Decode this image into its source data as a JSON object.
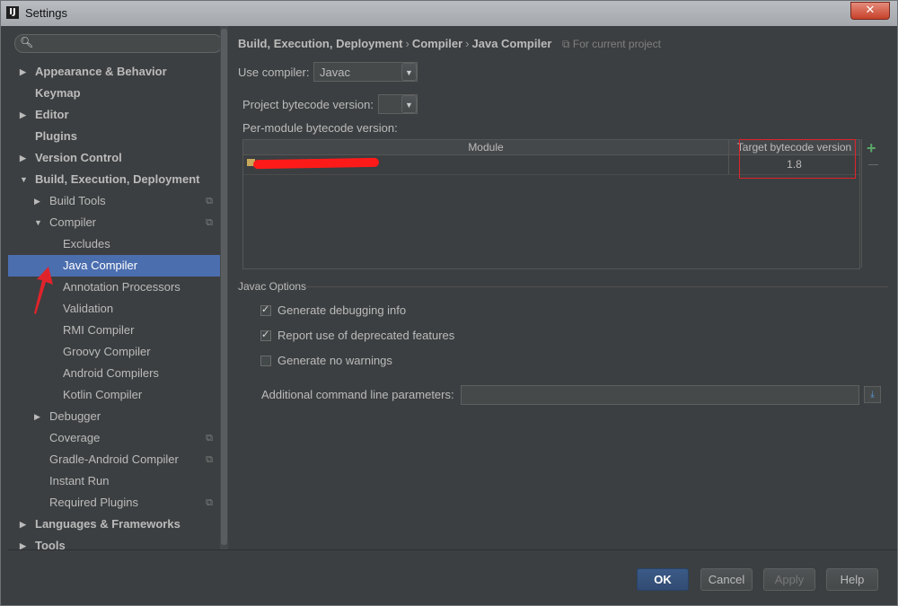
{
  "window": {
    "title": "Settings",
    "close_label": "✕"
  },
  "sidebar": {
    "search_placeholder": "",
    "items": [
      {
        "label": "Appearance & Behavior"
      },
      {
        "label": "Keymap"
      },
      {
        "label": "Editor"
      },
      {
        "label": "Plugins"
      },
      {
        "label": "Version Control"
      },
      {
        "label": "Build, Execution, Deployment"
      },
      {
        "label": "Build Tools"
      },
      {
        "label": "Compiler"
      },
      {
        "label": "Excludes"
      },
      {
        "label": "Java Compiler"
      },
      {
        "label": "Annotation Processors"
      },
      {
        "label": "Validation"
      },
      {
        "label": "RMI Compiler"
      },
      {
        "label": "Groovy Compiler"
      },
      {
        "label": "Android Compilers"
      },
      {
        "label": "Kotlin Compiler"
      },
      {
        "label": "Debugger"
      },
      {
        "label": "Coverage"
      },
      {
        "label": "Gradle-Android Compiler"
      },
      {
        "label": "Instant Run"
      },
      {
        "label": "Required Plugins"
      },
      {
        "label": "Languages & Frameworks"
      },
      {
        "label": "Tools"
      }
    ]
  },
  "breadcrumb": {
    "items": [
      "Build, Execution, Deployment",
      "Compiler",
      "Java Compiler"
    ],
    "separator": "›",
    "scope": "For current project"
  },
  "compiler": {
    "use_compiler_label": "Use compiler:",
    "use_compiler_value": "Javac",
    "project_bytecode_label": "Project bytecode version:",
    "project_bytecode_value": "",
    "per_module_label": "Per-module bytecode version:"
  },
  "module_table": {
    "columns": [
      "Module",
      "Target bytecode version"
    ],
    "rows": [
      {
        "module": "",
        "target": "1.8"
      }
    ]
  },
  "javac_options": {
    "title": "Javac Options",
    "checkboxes": [
      {
        "label": "Generate debugging info",
        "checked": true
      },
      {
        "label": "Report use of deprecated features",
        "checked": true
      },
      {
        "label": "Generate no warnings",
        "checked": false
      }
    ],
    "additional_params_label": "Additional command line parameters:",
    "additional_params_value": ""
  },
  "buttons": {
    "ok": "OK",
    "cancel": "Cancel",
    "apply": "Apply",
    "help": "Help"
  },
  "colors": {
    "accent": "#4b6eaf",
    "annotation": "#e0232b",
    "background": "#3c3f41"
  }
}
